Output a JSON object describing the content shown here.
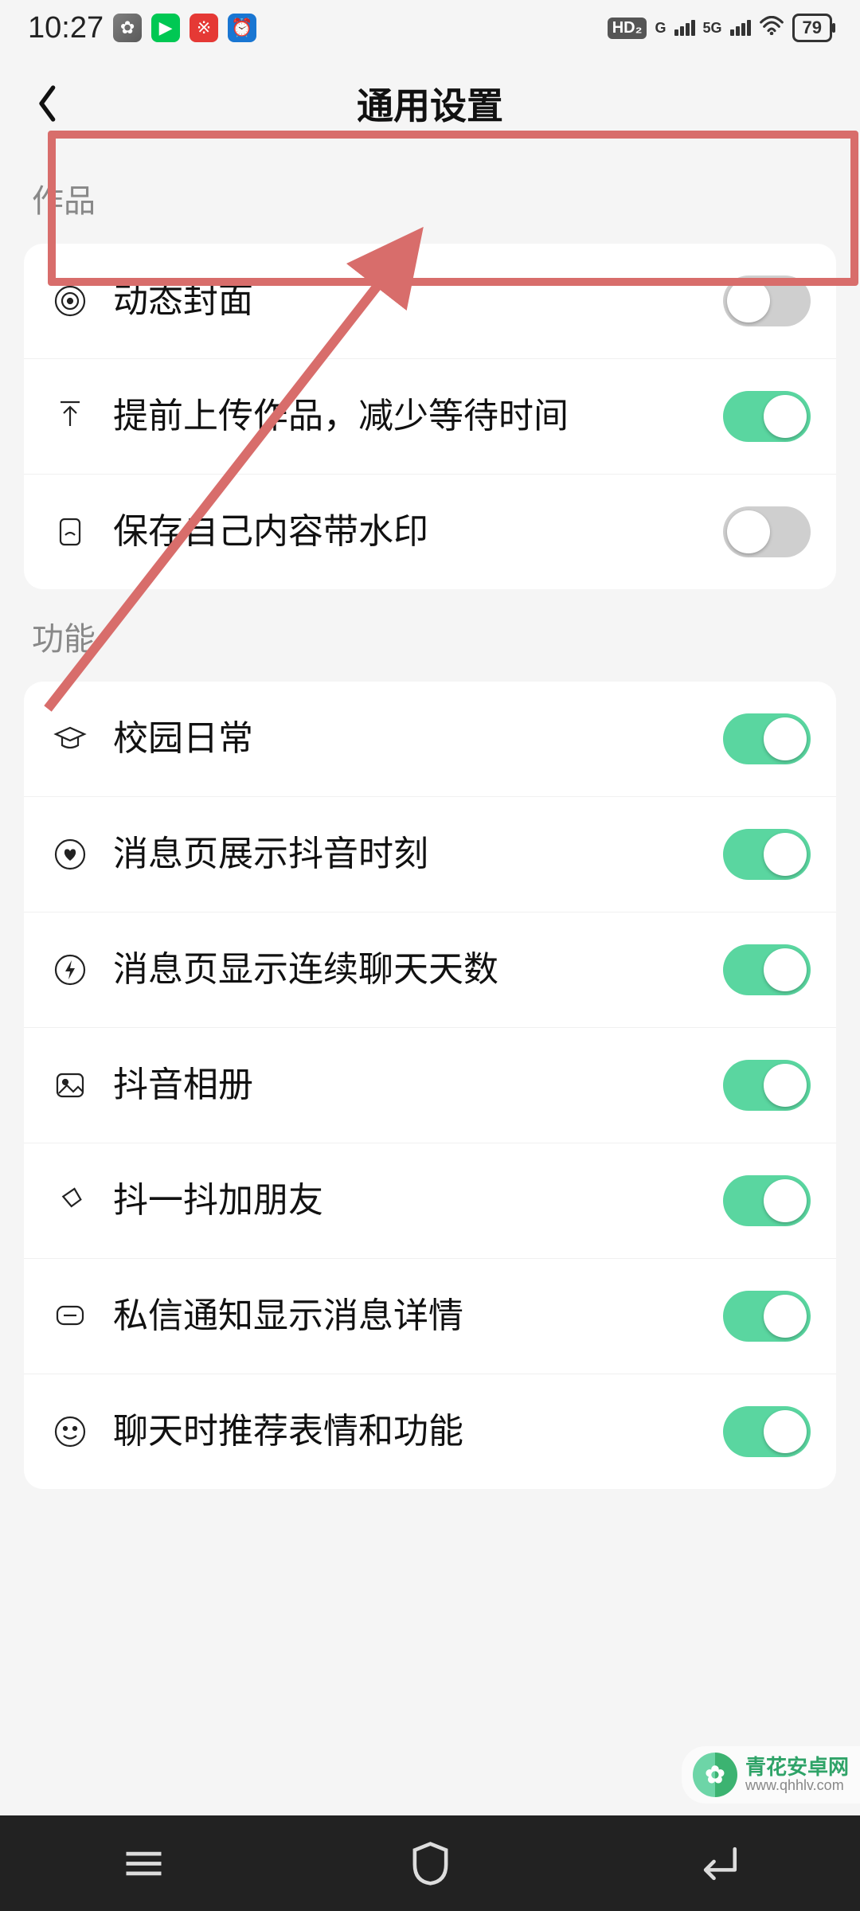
{
  "statusBar": {
    "time": "10:27",
    "hdBadge": "HD₂",
    "netG": "G",
    "net5G": "5G",
    "battery": "79"
  },
  "header": {
    "title": "通用设置"
  },
  "sections": [
    {
      "title": "作品",
      "items": [
        {
          "name": "dynamic-cover",
          "label": "动态封面",
          "on": false
        },
        {
          "name": "pre-upload",
          "label": "提前上传作品，减少等待时间",
          "on": true
        },
        {
          "name": "watermark-save",
          "label": "保存自己内容带水印",
          "on": false
        }
      ]
    },
    {
      "title": "功能",
      "items": [
        {
          "name": "campus-daily",
          "label": "校园日常",
          "on": true
        },
        {
          "name": "douyin-moments",
          "label": "消息页展示抖音时刻",
          "on": true
        },
        {
          "name": "chat-streak",
          "label": "消息页显示连续聊天天数",
          "on": true
        },
        {
          "name": "douyin-album",
          "label": "抖音相册",
          "on": true
        },
        {
          "name": "shake-friend",
          "label": "抖一抖加朋友",
          "on": true
        },
        {
          "name": "dm-detail",
          "label": "私信通知显示消息详情",
          "on": true
        },
        {
          "name": "chat-emoji",
          "label": "聊天时推荐表情和功能",
          "on": true
        }
      ]
    }
  ],
  "annotation": {
    "highlightColor": "#d86d6b"
  },
  "watermark": {
    "name": "青花安卓网",
    "url": "www.qhhlv.com"
  },
  "icons": {
    "dynamic-cover": "target",
    "pre-upload": "upload",
    "watermark-save": "device",
    "campus-daily": "graduation",
    "douyin-moments": "heart-circle",
    "chat-streak": "bolt",
    "douyin-album": "image",
    "shake-friend": "rotate",
    "dm-detail": "message",
    "chat-emoji": "smile"
  }
}
